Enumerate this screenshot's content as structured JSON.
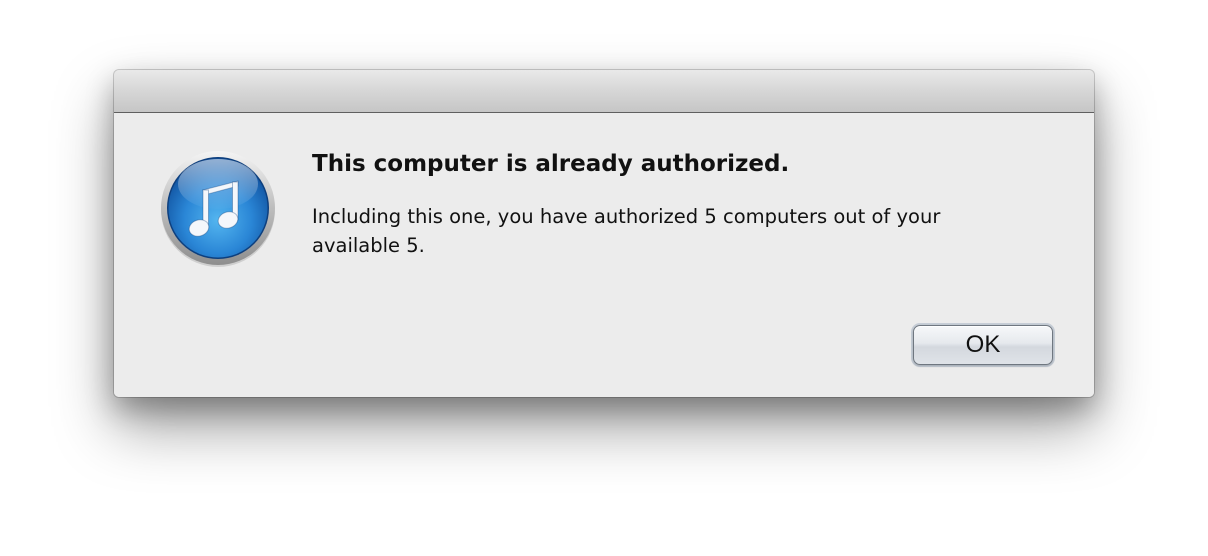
{
  "dialog": {
    "headline": "This computer is already authorized.",
    "message": "Including this one, you have authorized 5 computers out of your available 5.",
    "ok_label": "OK",
    "icon": "itunes-music-note-icon"
  },
  "colors": {
    "background": "#ececec",
    "icon_blue": "#1f72c4",
    "text": "#111111"
  }
}
